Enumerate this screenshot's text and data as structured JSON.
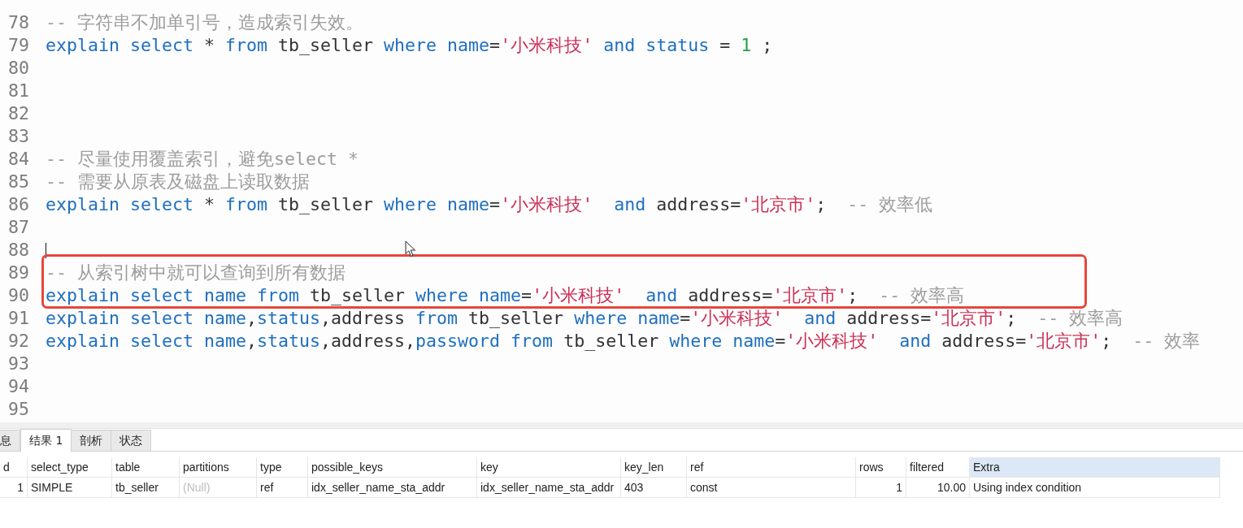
{
  "editor": {
    "lines": [
      {
        "number": "78",
        "highlighted": false,
        "cursor": false,
        "tokens": [
          {
            "kind": "comment",
            "text": "-- 字符串不加单引号，造成索引失效。"
          }
        ]
      },
      {
        "number": "79",
        "highlighted": false,
        "cursor": false,
        "tokens": [
          {
            "kind": "keyword",
            "text": "explain "
          },
          {
            "kind": "keyword",
            "text": "select "
          },
          {
            "kind": "plain",
            "text": "* "
          },
          {
            "kind": "keyword",
            "text": "from "
          },
          {
            "kind": "plain",
            "text": "tb_seller "
          },
          {
            "kind": "keyword",
            "text": "where "
          },
          {
            "kind": "keyword",
            "text": "name"
          },
          {
            "kind": "plain",
            "text": "="
          },
          {
            "kind": "string",
            "text": "'小米科技' "
          },
          {
            "kind": "keyword",
            "text": "and "
          },
          {
            "kind": "keyword",
            "text": "status "
          },
          {
            "kind": "plain",
            "text": "= "
          },
          {
            "kind": "number",
            "text": "1"
          },
          {
            "kind": "plain",
            "text": " ;"
          }
        ]
      },
      {
        "number": "80",
        "highlighted": false,
        "cursor": false
      },
      {
        "number": "81",
        "highlighted": false,
        "cursor": false
      },
      {
        "number": "82",
        "highlighted": false,
        "cursor": false
      },
      {
        "number": "83",
        "highlighted": false,
        "cursor": false
      },
      {
        "number": "84",
        "highlighted": false,
        "cursor": false,
        "tokens": [
          {
            "kind": "comment",
            "text": "-- 尽量使用覆盖索引，避免select *"
          }
        ]
      },
      {
        "number": "85",
        "highlighted": false,
        "cursor": false,
        "tokens": [
          {
            "kind": "comment",
            "text": "-- 需要从原表及磁盘上读取数据"
          }
        ]
      },
      {
        "number": "86",
        "highlighted": false,
        "cursor": false,
        "tokens": [
          {
            "kind": "keyword",
            "text": "explain "
          },
          {
            "kind": "keyword",
            "text": "select "
          },
          {
            "kind": "plain",
            "text": "* "
          },
          {
            "kind": "keyword",
            "text": "from "
          },
          {
            "kind": "plain",
            "text": "tb_seller "
          },
          {
            "kind": "keyword",
            "text": "where "
          },
          {
            "kind": "keyword",
            "text": "name"
          },
          {
            "kind": "plain",
            "text": "="
          },
          {
            "kind": "string",
            "text": "'小米科技'  "
          },
          {
            "kind": "keyword",
            "text": "and "
          },
          {
            "kind": "plain",
            "text": "address="
          },
          {
            "kind": "string",
            "text": "'北京市'"
          },
          {
            "kind": "plain",
            "text": ";  "
          },
          {
            "kind": "comment",
            "text": "-- 效率低"
          }
        ]
      },
      {
        "number": "87",
        "highlighted": false,
        "cursor": false
      },
      {
        "number": "88",
        "highlighted": false,
        "cursor": true
      },
      {
        "number": "89",
        "highlighted": true,
        "cursor": false,
        "tokens": [
          {
            "kind": "comment",
            "text": "-- 从索引树中就可以查询到所有数据"
          }
        ]
      },
      {
        "number": "90",
        "highlighted": true,
        "cursor": false,
        "tokens": [
          {
            "kind": "keyword",
            "text": "explain "
          },
          {
            "kind": "keyword",
            "text": "select "
          },
          {
            "kind": "keyword",
            "text": "name "
          },
          {
            "kind": "keyword",
            "text": "from "
          },
          {
            "kind": "plain",
            "text": "tb_seller "
          },
          {
            "kind": "keyword",
            "text": "where "
          },
          {
            "kind": "keyword",
            "text": "name"
          },
          {
            "kind": "plain",
            "text": "="
          },
          {
            "kind": "string",
            "text": "'小米科技'  "
          },
          {
            "kind": "keyword",
            "text": "and "
          },
          {
            "kind": "plain",
            "text": "address="
          },
          {
            "kind": "string",
            "text": "'北京市'"
          },
          {
            "kind": "plain",
            "text": ";  "
          },
          {
            "kind": "comment",
            "text": "-- 效率高"
          }
        ]
      },
      {
        "number": "91",
        "highlighted": false,
        "cursor": false,
        "tokens": [
          {
            "kind": "keyword",
            "text": "explain "
          },
          {
            "kind": "keyword",
            "text": "select "
          },
          {
            "kind": "keyword",
            "text": "name"
          },
          {
            "kind": "plain",
            "text": ","
          },
          {
            "kind": "keyword",
            "text": "status"
          },
          {
            "kind": "plain",
            "text": ",address "
          },
          {
            "kind": "keyword",
            "text": "from "
          },
          {
            "kind": "plain",
            "text": "tb_seller "
          },
          {
            "kind": "keyword",
            "text": "where "
          },
          {
            "kind": "keyword",
            "text": "name"
          },
          {
            "kind": "plain",
            "text": "="
          },
          {
            "kind": "string",
            "text": "'小米科技'  "
          },
          {
            "kind": "keyword",
            "text": "and "
          },
          {
            "kind": "plain",
            "text": "address="
          },
          {
            "kind": "string",
            "text": "'北京市'"
          },
          {
            "kind": "plain",
            "text": ";  "
          },
          {
            "kind": "comment",
            "text": "-- 效率高"
          }
        ]
      },
      {
        "number": "92",
        "highlighted": false,
        "cursor": false,
        "tokens": [
          {
            "kind": "keyword",
            "text": "explain "
          },
          {
            "kind": "keyword",
            "text": "select "
          },
          {
            "kind": "keyword",
            "text": "name"
          },
          {
            "kind": "plain",
            "text": ","
          },
          {
            "kind": "keyword",
            "text": "status"
          },
          {
            "kind": "plain",
            "text": ",address,"
          },
          {
            "kind": "keyword",
            "text": "password "
          },
          {
            "kind": "keyword",
            "text": "from "
          },
          {
            "kind": "plain",
            "text": "tb_seller "
          },
          {
            "kind": "keyword",
            "text": "where "
          },
          {
            "kind": "keyword",
            "text": "name"
          },
          {
            "kind": "plain",
            "text": "="
          },
          {
            "kind": "string",
            "text": "'小米科技'  "
          },
          {
            "kind": "keyword",
            "text": "and "
          },
          {
            "kind": "plain",
            "text": "address="
          },
          {
            "kind": "string",
            "text": "'北京市'"
          },
          {
            "kind": "plain",
            "text": ";  "
          },
          {
            "kind": "comment",
            "text": "-- 效率"
          }
        ]
      },
      {
        "number": "93",
        "highlighted": false,
        "cursor": false
      },
      {
        "number": "94",
        "highlighted": false,
        "cursor": false
      },
      {
        "number": "95",
        "highlighted": false,
        "cursor": false
      }
    ]
  },
  "result_panel": {
    "tabs": [
      {
        "label": "息",
        "selected": false
      },
      {
        "label": "结果 1",
        "selected": true
      },
      {
        "label": "剖析",
        "selected": false
      },
      {
        "label": "状态",
        "selected": false
      }
    ],
    "table": {
      "columns": [
        {
          "label": "d",
          "kind": "number",
          "selected": false
        },
        {
          "label": "select_type",
          "kind": "text",
          "selected": false
        },
        {
          "label": "table",
          "kind": "text",
          "selected": false
        },
        {
          "label": "partitions",
          "kind": "text",
          "selected": false
        },
        {
          "label": "type",
          "kind": "text",
          "selected": false
        },
        {
          "label": "possible_keys",
          "kind": "text",
          "selected": false
        },
        {
          "label": "key",
          "kind": "text",
          "selected": false
        },
        {
          "label": "key_len",
          "kind": "text",
          "selected": false
        },
        {
          "label": "ref",
          "kind": "text",
          "selected": false
        },
        {
          "label": "rows",
          "kind": "number",
          "selected": false
        },
        {
          "label": "filtered",
          "kind": "number",
          "selected": false
        },
        {
          "label": "Extra",
          "kind": "text",
          "selected": true
        }
      ],
      "rows": [
        {
          "cells": [
            {
              "text": "1",
              "null": false
            },
            {
              "text": "SIMPLE",
              "null": false
            },
            {
              "text": "tb_seller",
              "null": false
            },
            {
              "text": "(Null)",
              "null": true
            },
            {
              "text": "ref",
              "null": false
            },
            {
              "text": "idx_seller_name_sta_addr",
              "null": false
            },
            {
              "text": "idx_seller_name_sta_addr",
              "null": false
            },
            {
              "text": "403",
              "null": false
            },
            {
              "text": "const",
              "null": false
            },
            {
              "text": "1",
              "null": false
            },
            {
              "text": "10.00",
              "null": false
            },
            {
              "text": "Using index condition",
              "null": false
            }
          ]
        }
      ]
    }
  }
}
